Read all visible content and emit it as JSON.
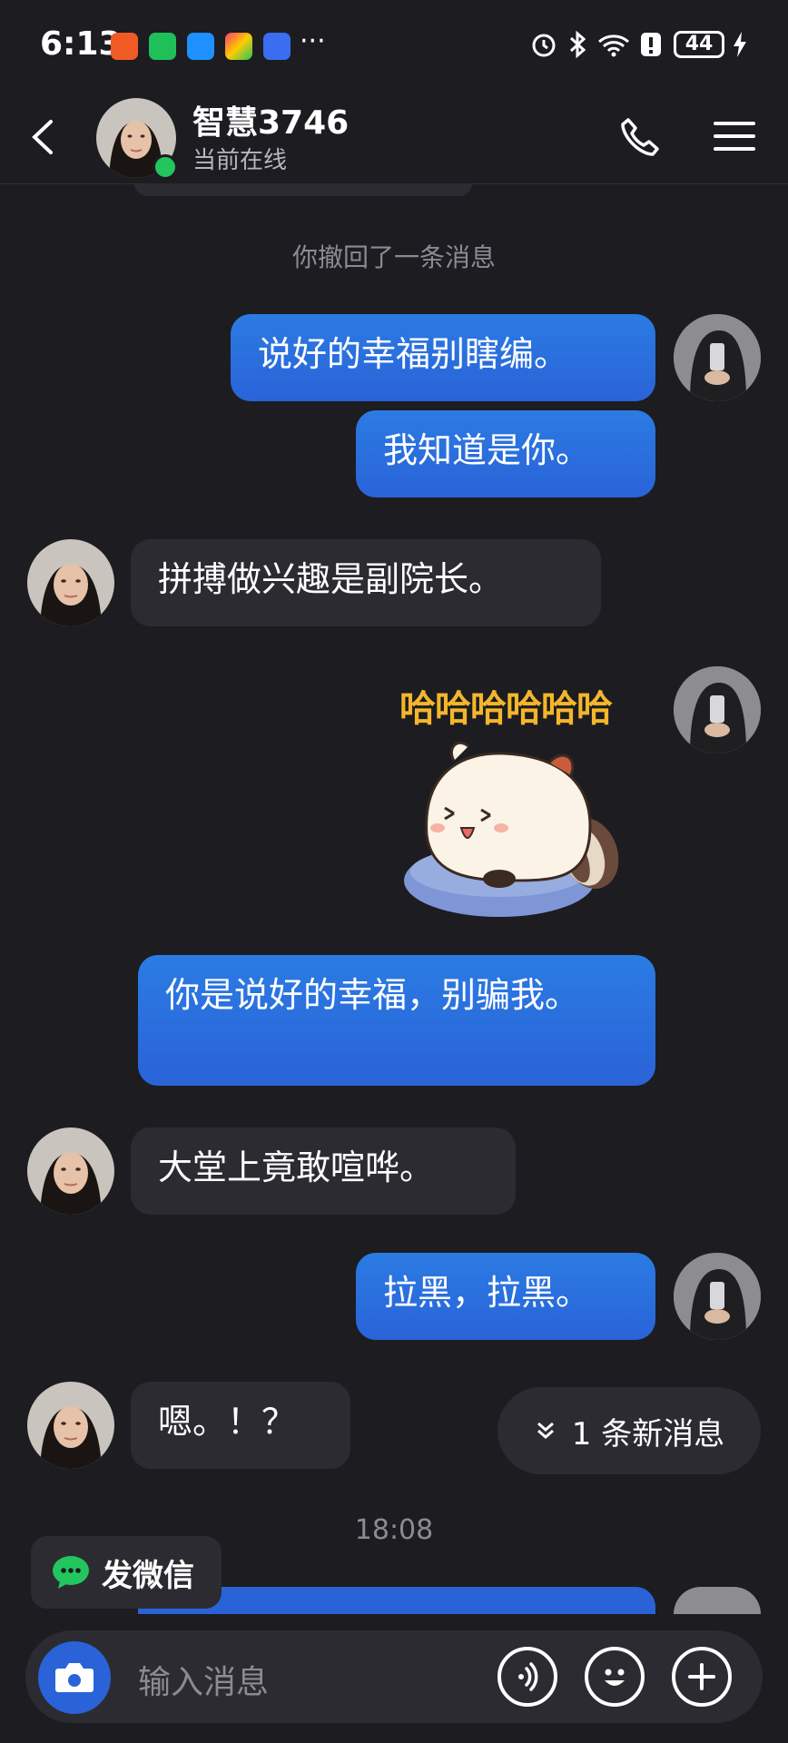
{
  "status_bar": {
    "time": "6:13",
    "more": "···",
    "battery": "44"
  },
  "header": {
    "contact_name": "智慧3746",
    "status": "当前在线"
  },
  "messages": {
    "system_recalled": "你撤回了一条消息",
    "out_1": "说好的幸福别瞎编。",
    "out_2": "我知道是你。",
    "in_1": "拼搏做兴趣是副院长。",
    "sticker_text": "哈哈哈哈哈哈",
    "out_3": "你是说好的幸福，别骗我。",
    "in_2": "大堂上竟敢喧哗。",
    "out_4": "拉黑，拉黑。",
    "in_3": "嗯。！？",
    "timestamp": "18:08"
  },
  "new_messages_pill": "1 条新消息",
  "wechat_button": "发微信",
  "input": {
    "placeholder": "输入消息"
  },
  "colors": {
    "background": "#1c1c21",
    "outgoing_bubble": "#2a63d8",
    "incoming_bubble": "#2b2b31",
    "online": "#22c55e"
  }
}
